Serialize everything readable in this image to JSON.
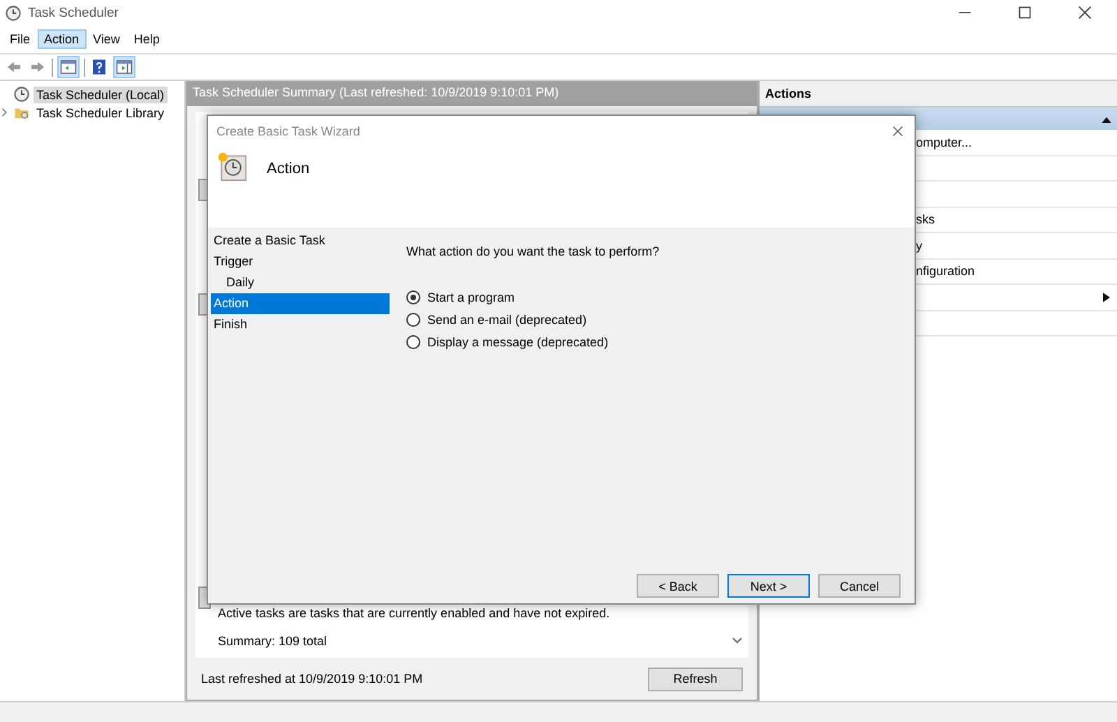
{
  "window": {
    "title": "Task Scheduler"
  },
  "menu": [
    {
      "label": "File",
      "selected": false
    },
    {
      "label": "Action",
      "selected": true
    },
    {
      "label": "View",
      "selected": false
    },
    {
      "label": "Help",
      "selected": false
    }
  ],
  "tree": [
    {
      "label": "Task Scheduler (Local)",
      "selected": true,
      "kind": "clock"
    },
    {
      "label": "Task Scheduler Library",
      "selected": false,
      "kind": "folder",
      "expanded": false
    }
  ],
  "summary": {
    "title": "Task Scheduler Summary (Last refreshed: 10/9/2019 9:10:01 PM)",
    "note": "Active tasks are tasks that are currently enabled and have not expired.",
    "total": "Summary: 109 total",
    "last_refreshed": "Last refreshed at 10/9/2019 9:10:01 PM",
    "refresh_button": "Refresh"
  },
  "actions": {
    "title": "Actions",
    "items": [
      {
        "label": "omputer...",
        "kind": "text"
      },
      {
        "kind": "blank"
      },
      {
        "kind": "blank"
      },
      {
        "label": "sks",
        "kind": "text"
      },
      {
        "label": "y",
        "kind": "text"
      },
      {
        "label": "nfiguration",
        "kind": "text"
      },
      {
        "kind": "submenu"
      },
      {
        "kind": "blank"
      }
    ]
  },
  "dialog": {
    "title": "Create Basic Task Wizard",
    "heading": "Action",
    "steps": [
      {
        "label": "Create a Basic Task",
        "selected": false
      },
      {
        "label": "Trigger",
        "selected": false,
        "children": [
          {
            "label": "Daily",
            "selected": false
          }
        ]
      },
      {
        "label": "Action",
        "selected": true
      },
      {
        "label": "Finish",
        "selected": false
      }
    ],
    "question": "What action do you want the task to perform?",
    "options": [
      {
        "label": "Start a program",
        "selected": true
      },
      {
        "label": "Send an e-mail (deprecated)",
        "selected": false
      },
      {
        "label": "Display a message (deprecated)",
        "selected": false
      }
    ],
    "buttons": [
      {
        "label": "< Back",
        "default": false
      },
      {
        "label": "Next >",
        "default": true
      },
      {
        "label": "Cancel",
        "default": false
      }
    ]
  }
}
